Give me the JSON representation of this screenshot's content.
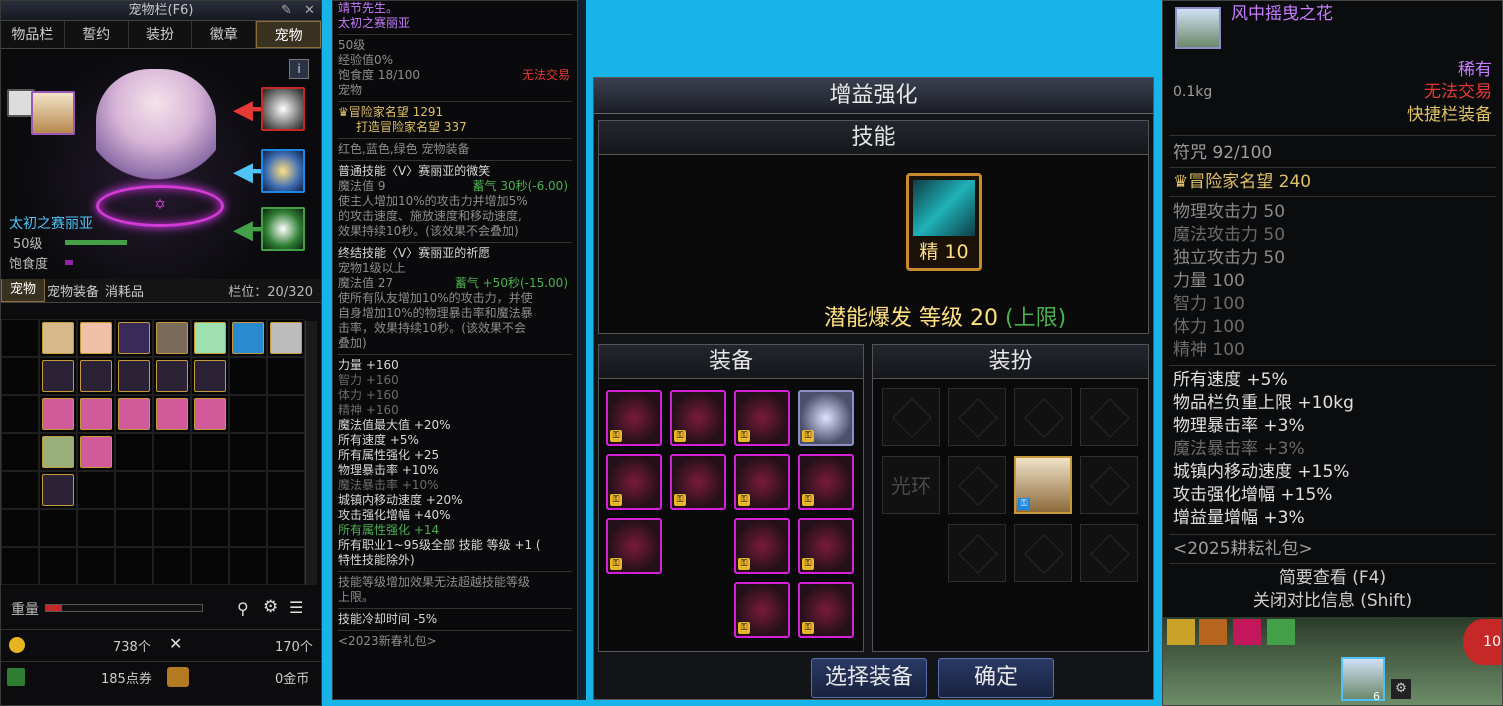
{
  "pet_window": {
    "title": "宠物栏(F6)",
    "tabs": [
      "物品栏",
      "誓约",
      "装扮",
      "徽章",
      "宠物"
    ],
    "info_label": "i",
    "pet_name": "太初之赛丽亚",
    "level": "50级",
    "satiety_label": "饱食度",
    "subtabs": [
      "宠物",
      "宠物装备",
      "消耗品"
    ],
    "capacity": "栏位：20/320",
    "weight_label": "重量",
    "gold_count": "738个",
    "item_count": "170个",
    "points": "185点券",
    "coins": "0金币",
    "circle_glyph": "✡"
  },
  "tooltip": {
    "header_lines": [
      "靖节先生。",
      "太初之赛丽亚"
    ],
    "level": "50级",
    "exp": "经验值0%",
    "satiety": "饱食度 18/100",
    "untradeable": "无法交易",
    "type": "宠物",
    "fame": "冒险家名望 1291",
    "forge_fame": "打造冒险家名望 337",
    "equip_colors": "红色,蓝色,绿色 宠物装备",
    "skill1_title": "普通技能〈V〉赛丽亚的微笑",
    "skill1_mp": "魔法值 9",
    "skill1_cd": "蓄气 30秒(-6.00)",
    "skill1_desc": [
      "使主人增加10%的攻击力并增加5%",
      "的攻击速度、施放速度和移动速度,",
      "效果持续10秒。(该效果不会叠加)"
    ],
    "skill2_title": "终结技能〈V〉赛丽亚的祈愿",
    "skill2_req": "宠物1级以上",
    "skill2_mp": "魔法值 27",
    "skill2_cd": "蓄气 +50秒(-15.00)",
    "skill2_desc": [
      "使所有队友增加10%的攻击力，并使",
      "自身增加10%的物理暴击率和魔法暴",
      "击率，效果持续10秒。(该效果不会",
      "叠加)"
    ],
    "stats": [
      "力量 +160",
      "智力 +160",
      "体力 +160",
      "精神 +160",
      "魔法值最大值 +20%",
      "所有速度 +5%",
      "所有属性强化 +25",
      "物理暴击率 +10%",
      "魔法暴击率 +10%",
      "城镇内移动速度 +20%",
      "攻击强化增幅 +40%",
      "所有属性强化 +14",
      "所有职业1~95级全部 技能 等级 +1 (",
      "特性技能除外)"
    ],
    "note": [
      "技能等级增加效果无法超越技能等级",
      "上限。"
    ],
    "cooldown": "技能冷却时间 -5%",
    "package": "<2023新春礼包>"
  },
  "enhance": {
    "title": "增益强化",
    "skill_head": "技能",
    "skill_badge": "精 10",
    "skill_line_main": "潜能爆发 等级 20",
    "skill_line_cap": "(上限)",
    "equip_head": "装备",
    "avatar_head": "装扮",
    "aura_label": "光环",
    "btn_select": "选择装备",
    "btn_confirm": "确定"
  },
  "item_tooltip": {
    "name": "风中摇曳之花",
    "rarity": "稀有",
    "weight": "0.1kg",
    "untradeable": "无法交易",
    "hotbar": "快捷栏装备",
    "charm": "符咒 92/100",
    "fame": "冒险家名望 240",
    "stats_dim": [
      "物理攻击力 50",
      "魔法攻击力 50",
      "独立攻击力 50",
      "力量 100",
      "智力 100",
      "体力 100",
      "精神 100"
    ],
    "bonuses": [
      "所有速度 +5%",
      "物品栏负重上限 +10kg",
      "物理暴击率 +3%",
      "魔法暴击率 +3%",
      "城镇内移动速度 +15%",
      "攻击强化增幅 +15%",
      "增益量增幅 +3%"
    ],
    "package": "<2025耕耘礼包>",
    "quick_view": "简要查看 (F4)",
    "close_compare": "关闭对比信息 (Shift)",
    "hotbar_counter": "10",
    "slot_badge": "6"
  },
  "colors": {
    "background": "#17b4ea",
    "accent_gold": "#c49a3a",
    "magenta": "#d620d6",
    "cap_green": "#4caf50"
  }
}
